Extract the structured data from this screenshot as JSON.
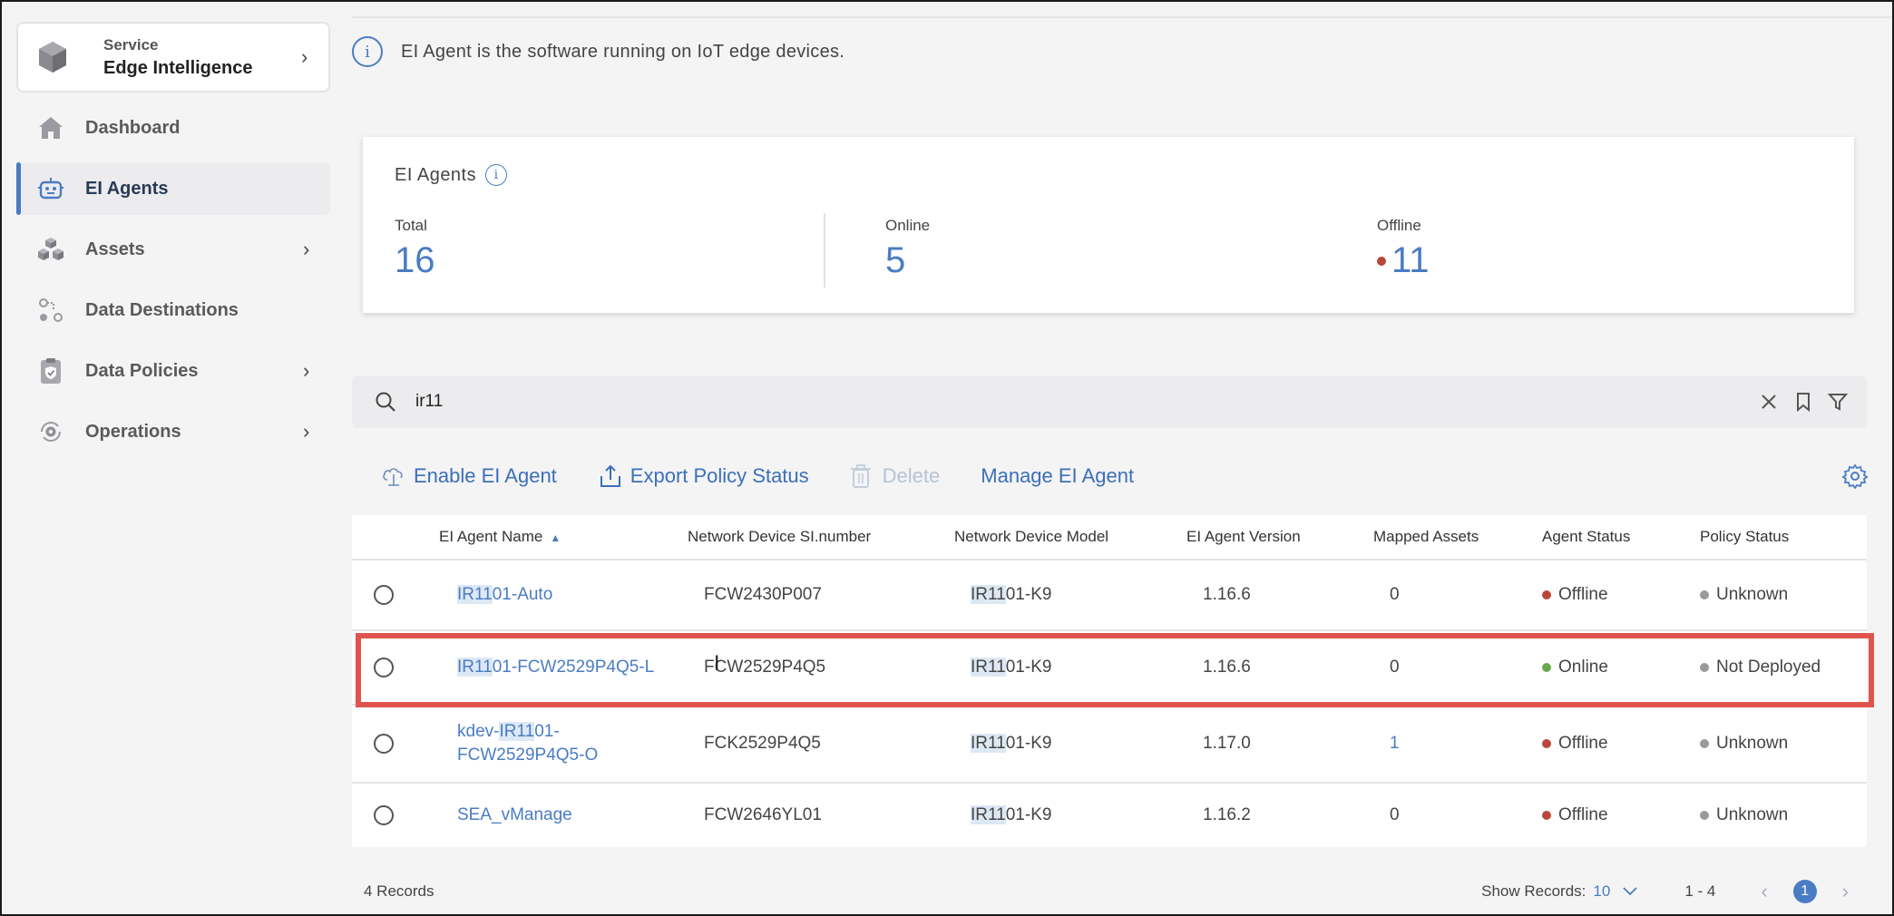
{
  "service": {
    "label": "Service",
    "name": "Edge Intelligence"
  },
  "nav": [
    {
      "label": "Dashboard",
      "icon": "home-icon"
    },
    {
      "label": "EI Agents",
      "icon": "robot-icon",
      "active": true
    },
    {
      "label": "Assets",
      "icon": "cubes-icon",
      "chevron": true
    },
    {
      "label": "Data Destinations",
      "icon": "flow-icon"
    },
    {
      "label": "Data Policies",
      "icon": "clipboard-shield-icon",
      "chevron": true
    },
    {
      "label": "Operations",
      "icon": "gear-cycle-icon",
      "chevron": true
    }
  ],
  "info_banner": "EI Agent is the software running on IoT edge devices.",
  "stats": {
    "title": "EI Agents",
    "total_label": "Total",
    "total": "16",
    "online_label": "Online",
    "online": "5",
    "offline_label": "Offline",
    "offline": "11"
  },
  "search": {
    "value": "ir11"
  },
  "toolbar": {
    "enable": "Enable EI Agent",
    "export": "Export Policy Status",
    "delete": "Delete",
    "manage": "Manage EI Agent"
  },
  "table": {
    "headers": [
      "EI Agent Name",
      "Network Device SI.number",
      "Network Device Model",
      "EI Agent Version",
      "Mapped Assets",
      "Agent Status",
      "Policy Status"
    ],
    "rows": [
      {
        "name_pre": "",
        "name_hl": "IR11",
        "name_post": "01-Auto",
        "serial": "FCW2430P007",
        "model_hl": "IR11",
        "model_post": "01-K9",
        "version": "1.16.6",
        "assets": "0",
        "agent_status": "Offline",
        "policy_status": "Unknown"
      },
      {
        "name_pre": "",
        "name_hl": "IR11",
        "name_post": "01-FCW2529P4Q5-L",
        "serial": "FCW2529P4Q5",
        "model_hl": "IR11",
        "model_post": "01-K9",
        "version": "1.16.6",
        "assets": "0",
        "agent_status": "Online",
        "policy_status": "Not Deployed"
      },
      {
        "name_pre": "kdev-",
        "name_hl": "IR11",
        "name_post": "01-",
        "name_line2": "FCW2529P4Q5-O",
        "serial": "FCK2529P4Q5",
        "model_hl": "IR11",
        "model_post": "01-K9",
        "version": "1.17.0",
        "assets": "1",
        "agent_status": "Offline",
        "policy_status": "Unknown"
      },
      {
        "name_pre": "SEA_vManage",
        "name_hl": "",
        "name_post": "",
        "serial": "FCW2646YL01",
        "model_hl": "IR11",
        "model_post": "01-K9",
        "version": "1.16.2",
        "assets": "0",
        "agent_status": "Offline",
        "policy_status": "Unknown"
      }
    ]
  },
  "footer": {
    "records": "4 Records",
    "show_label": "Show Records:",
    "show_value": "10",
    "range": "1 - 4",
    "page": "1"
  },
  "colors": {
    "accent": "#4a7cc4",
    "offline": "#b9473b",
    "online": "#6aa84f",
    "unknown": "#9a9a9a",
    "highlight_box": "#e0544f"
  }
}
